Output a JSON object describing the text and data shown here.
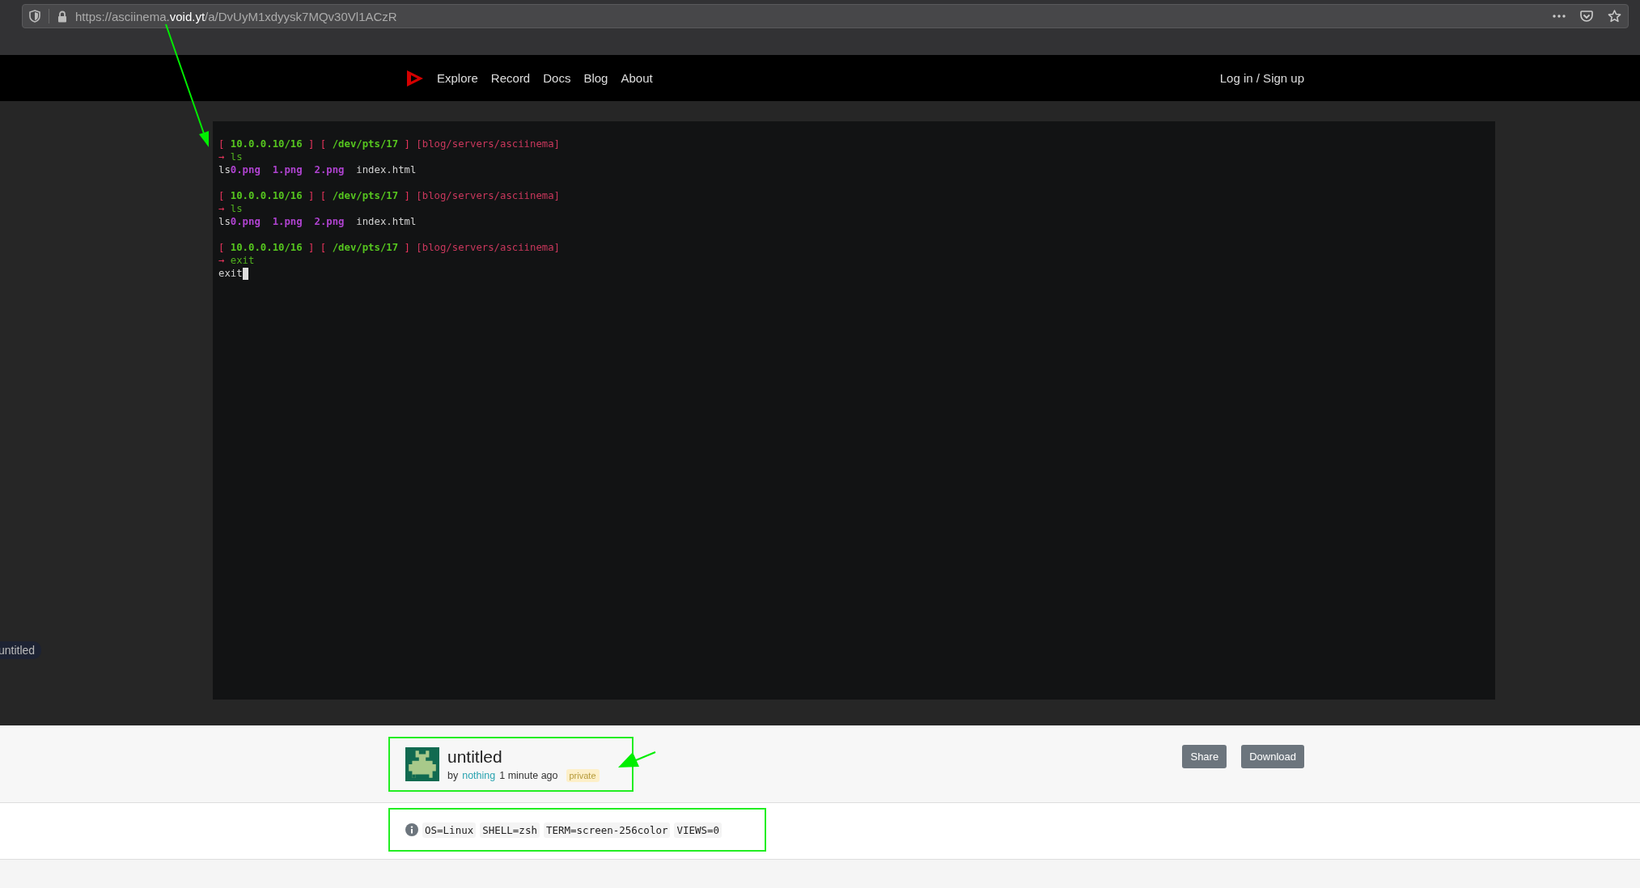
{
  "browser": {
    "url": {
      "prefix": "https://asciinema.",
      "domain": "void.yt",
      "path": "/a/DvUyM1xdyysk7MQv30Vl1ACzR"
    }
  },
  "nav": {
    "links": [
      "Explore",
      "Record",
      "Docs",
      "Blog",
      "About"
    ],
    "login": "Log in / Sign up"
  },
  "terminal": {
    "cursor": true,
    "blocks": [
      {
        "lines": [
          {
            "segments": [
              {
                "text": "[ ",
                "kind": "bracket"
              },
              {
                "text": "10.0.0.10/16",
                "kind": "address"
              },
              {
                "text": " ] [ ",
                "kind": "bracket"
              },
              {
                "text": "/dev/pts/17",
                "kind": "address"
              },
              {
                "text": " ] ",
                "kind": "bracket"
              },
              {
                "text": "[blog/servers/asciinema]",
                "kind": "cwd"
              }
            ]
          },
          {
            "segments": [
              {
                "text": "→ ",
                "kind": "bracket"
              },
              {
                "text": "ls",
                "kind": "command"
              }
            ]
          },
          {
            "segments": [
              {
                "text": "ls",
                "kind": "output"
              },
              {
                "text": "0.png",
                "kind": "file"
              },
              {
                "text": "  1.png",
                "kind": "file"
              },
              {
                "text": "  2.png",
                "kind": "file"
              },
              {
                "text": "  index.html",
                "kind": "output"
              }
            ]
          }
        ]
      },
      {
        "lines": [
          {
            "segments": [
              {
                "text": "[ ",
                "kind": "bracket"
              },
              {
                "text": "10.0.0.10/16",
                "kind": "address"
              },
              {
                "text": " ] [ ",
                "kind": "bracket"
              },
              {
                "text": "/dev/pts/17",
                "kind": "address"
              },
              {
                "text": " ] ",
                "kind": "bracket"
              },
              {
                "text": "[blog/servers/asciinema]",
                "kind": "cwd"
              }
            ]
          },
          {
            "segments": [
              {
                "text": "→ ",
                "kind": "bracket"
              },
              {
                "text": "ls",
                "kind": "command"
              }
            ]
          },
          {
            "segments": [
              {
                "text": "ls",
                "kind": "output"
              },
              {
                "text": "0.png",
                "kind": "file"
              },
              {
                "text": "  1.png",
                "kind": "file"
              },
              {
                "text": "  2.png",
                "kind": "file"
              },
              {
                "text": "  index.html",
                "kind": "output"
              }
            ]
          }
        ]
      },
      {
        "lines": [
          {
            "segments": [
              {
                "text": "[ ",
                "kind": "bracket"
              },
              {
                "text": "10.0.0.10/16",
                "kind": "address"
              },
              {
                "text": " ] [ ",
                "kind": "bracket"
              },
              {
                "text": "/dev/pts/17",
                "kind": "address"
              },
              {
                "text": " ] ",
                "kind": "bracket"
              },
              {
                "text": "[blog/servers/asciinema]",
                "kind": "cwd"
              }
            ]
          },
          {
            "segments": [
              {
                "text": "→ ",
                "kind": "bracket"
              },
              {
                "text": "exit",
                "kind": "command"
              }
            ]
          },
          {
            "segments": [
              {
                "text": "exit",
                "kind": "output"
              }
            ]
          }
        ]
      }
    ]
  },
  "side_tooltip": "untitled",
  "recording": {
    "title": "untitled",
    "by": "by",
    "author": "nothing",
    "time": "1 minute ago",
    "badge": "private"
  },
  "actions": [
    "Share",
    "Download"
  ],
  "env": [
    "OS=Linux",
    "SHELL=zsh",
    "TERM=screen-256color",
    "VIEWS=0"
  ]
}
